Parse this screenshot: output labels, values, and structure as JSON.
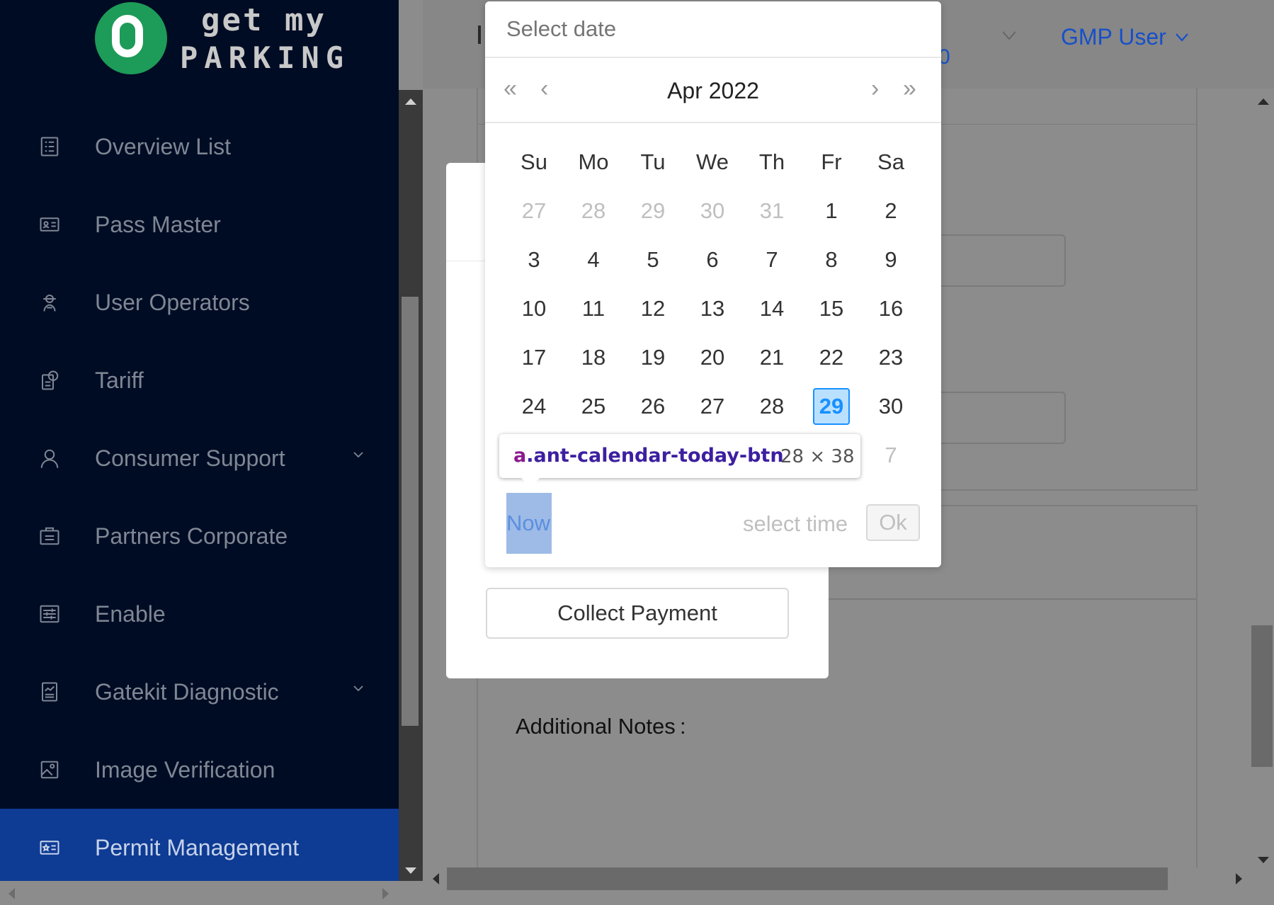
{
  "logo": {
    "line1": "get my",
    "line2": "PARKING"
  },
  "sidebar": {
    "items": [
      {
        "label": "Overview List",
        "icon": "list-icon",
        "has_submenu": false,
        "active": false
      },
      {
        "label": "Pass Master",
        "icon": "id-card-icon",
        "has_submenu": false,
        "active": false
      },
      {
        "label": "User Operators",
        "icon": "operator-icon",
        "has_submenu": false,
        "active": false
      },
      {
        "label": "Tariff",
        "icon": "tariff-icon",
        "has_submenu": false,
        "active": false
      },
      {
        "label": "Consumer Support",
        "icon": "user-icon",
        "has_submenu": true,
        "active": false
      },
      {
        "label": "Partners Corporate",
        "icon": "briefcase-icon",
        "has_submenu": false,
        "active": false
      },
      {
        "label": "Enable",
        "icon": "sliders-icon",
        "has_submenu": false,
        "active": false
      },
      {
        "label": "Gatekit Diagnostic",
        "icon": "report-icon",
        "has_submenu": true,
        "active": false
      },
      {
        "label": "Image Verification",
        "icon": "image-icon",
        "has_submenu": false,
        "active": false
      },
      {
        "label": "Permit Management",
        "icon": "permit-card-icon",
        "has_submenu": false,
        "active": true
      }
    ]
  },
  "header": {
    "partial_link_text": "0",
    "user_name": "GMP User"
  },
  "content": {
    "additional_notes_label": "Additional Notes :"
  },
  "modal": {
    "collect_payment_label": "Collect Payment"
  },
  "calendar": {
    "input_placeholder": "Select date",
    "month_year": "Apr 2022",
    "prev_year": "«",
    "prev_month": "‹",
    "next_month": "›",
    "next_year": "»",
    "weekdays": [
      "Su",
      "Mo",
      "Tu",
      "We",
      "Th",
      "Fr",
      "Sa"
    ],
    "weeks": [
      [
        "27",
        "28",
        "29",
        "30",
        "31",
        "1",
        "2"
      ],
      [
        "3",
        "4",
        "5",
        "6",
        "7",
        "8",
        "9"
      ],
      [
        "10",
        "11",
        "12",
        "13",
        "14",
        "15",
        "16"
      ],
      [
        "17",
        "18",
        "19",
        "20",
        "21",
        "22",
        "23"
      ],
      [
        "24",
        "25",
        "26",
        "27",
        "28",
        "29",
        "30"
      ],
      [
        "",
        "",
        "",
        "",
        "",
        "",
        "7"
      ]
    ],
    "today": "29",
    "now_label": "Now",
    "select_time_label": "select time",
    "ok_label": "Ok"
  },
  "inspector_tooltip": {
    "tag": "a",
    "class_name": ".ant-calendar-today-btn",
    "dimensions": "28 × 38"
  },
  "colors": {
    "sidebar_bg": "#000c24",
    "sidebar_active": "#0e3b94",
    "accent_blue": "#1890ff",
    "link_blue": "#1650c8",
    "logo_green": "#1d9b58"
  }
}
